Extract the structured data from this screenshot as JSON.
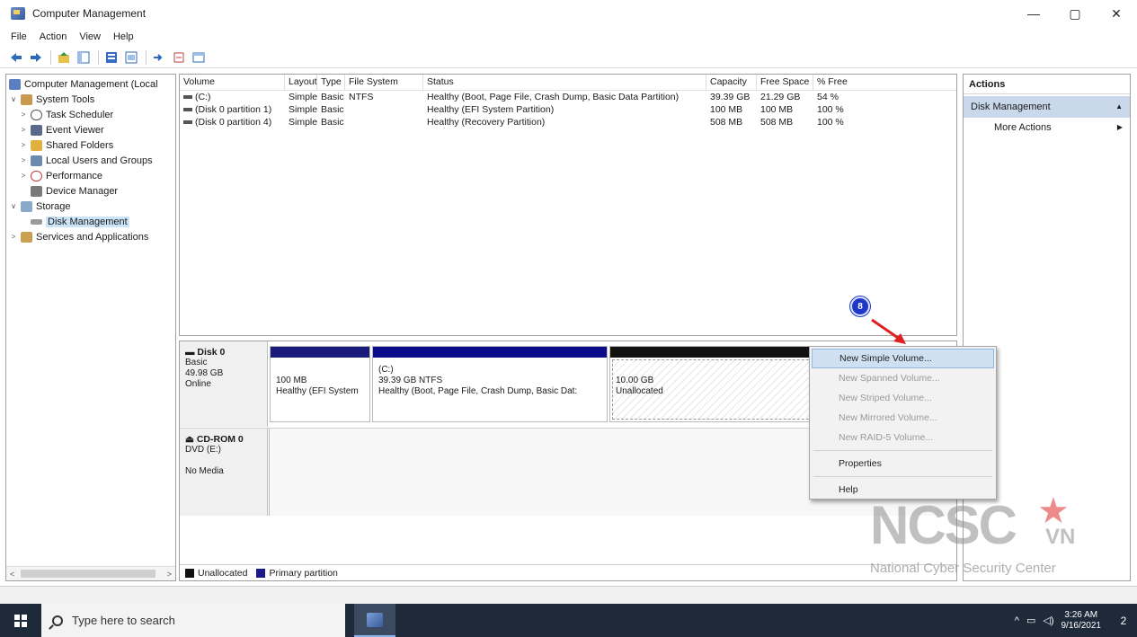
{
  "window": {
    "title": "Computer Management",
    "controls": {
      "minimize": "—",
      "maximize": "▢",
      "close": "✕"
    }
  },
  "menu": [
    "File",
    "Action",
    "View",
    "Help"
  ],
  "toolbar_icons": [
    "back-icon",
    "forward-icon",
    "up-folder-icon",
    "show-tree-icon",
    "properties-icon",
    "help-icon",
    "export-icon",
    "connect-icon",
    "refresh-icon"
  ],
  "tree": {
    "root": "Computer Management (Local",
    "items": [
      {
        "label": "System Tools",
        "level": 1,
        "expander": "∨",
        "icon": "tools-icon"
      },
      {
        "label": "Task Scheduler",
        "level": 2,
        "expander": ">",
        "icon": "clock-icon"
      },
      {
        "label": "Event Viewer",
        "level": 2,
        "expander": ">",
        "icon": "event-viewer-icon"
      },
      {
        "label": "Shared Folders",
        "level": 2,
        "expander": ">",
        "icon": "shared-folder-icon"
      },
      {
        "label": "Local Users and Groups",
        "level": 2,
        "expander": ">",
        "icon": "users-icon"
      },
      {
        "label": "Performance",
        "level": 2,
        "expander": ">",
        "icon": "performance-icon"
      },
      {
        "label": "Device Manager",
        "level": 2,
        "expander": "",
        "icon": "device-manager-icon"
      },
      {
        "label": "Storage",
        "level": 1,
        "expander": "∨",
        "icon": "storage-icon"
      },
      {
        "label": "Disk Management",
        "level": 2,
        "expander": "",
        "icon": "disk-icon"
      },
      {
        "label": "Services and Applications",
        "level": 1,
        "expander": ">",
        "icon": "services-icon"
      }
    ],
    "scroll_left": "<",
    "scroll_right": ">"
  },
  "volumes": {
    "columns": [
      "Volume",
      "Layout",
      "Type",
      "File System",
      "Status",
      "Capacity",
      "Free Space",
      "% Free"
    ],
    "rows": [
      [
        "(C:)",
        "Simple",
        "Basic",
        "NTFS",
        "Healthy (Boot, Page File, Crash Dump, Basic Data Partition)",
        "39.39 GB",
        "21.29 GB",
        "54 %"
      ],
      [
        "(Disk 0 partition 1)",
        "Simple",
        "Basic",
        "",
        "Healthy (EFI System Partition)",
        "100 MB",
        "100 MB",
        "100 %"
      ],
      [
        "(Disk 0 partition 4)",
        "Simple",
        "Basic",
        "",
        "Healthy (Recovery Partition)",
        "508 MB",
        "508 MB",
        "100 %"
      ]
    ]
  },
  "disk0": {
    "name": "Disk 0",
    "type": "Basic",
    "size": "49.98 GB",
    "status": "Online",
    "partitions": [
      {
        "line1": "100 MB",
        "line2": "Healthy (EFI System",
        "bar_color": "#1b1b7a"
      },
      {
        "line1": "(C:)",
        "line2": "39.39 GB NTFS",
        "line3": "Healthy (Boot, Page File, Crash Dump, Basic Dat:",
        "bar_color": "#0c0c8a"
      },
      {
        "line1": "10.00 GB",
        "line2": "Unallocated",
        "bar_color": "#111111"
      }
    ]
  },
  "cdrom0": {
    "name": "CD-ROM 0",
    "drive": "DVD (E:)",
    "media": "No Media"
  },
  "legend": [
    {
      "label": "Unallocated",
      "color": "#111111"
    },
    {
      "label": "Primary partition",
      "color": "#1a1a8a"
    }
  ],
  "actions": {
    "header": "Actions",
    "section": "Disk Management",
    "section_arrow": "▲",
    "items": [
      {
        "label": "More Actions",
        "arrow": "▶"
      }
    ]
  },
  "context_menu": {
    "items": [
      {
        "label": "New Simple Volume...",
        "state": "highlighted"
      },
      {
        "label": "New Spanned Volume...",
        "state": "disabled"
      },
      {
        "label": "New Striped Volume...",
        "state": "disabled"
      },
      {
        "label": "New Mirrored Volume...",
        "state": "disabled"
      },
      {
        "label": "New RAID-5 Volume...",
        "state": "disabled"
      },
      {
        "label": "Properties",
        "state": "enabled"
      },
      {
        "label": "Help",
        "state": "enabled"
      }
    ]
  },
  "step_badge": "8",
  "watermark": {
    "logo": "NCSC",
    "country": "VN",
    "subtitle": "National Cyber Security Center"
  },
  "taskbar": {
    "search_placeholder": "Type here to search",
    "time": "3:26 AM",
    "date": "9/16/2021",
    "tray_chevron": "^",
    "notifications_badge": "2"
  },
  "colors": {
    "accent_selection": "#cce4f7",
    "context_highlight": "#cfe0f2",
    "badge": "#2038c8",
    "arrow": "#e02020",
    "taskbar": "#1e2a3a"
  }
}
